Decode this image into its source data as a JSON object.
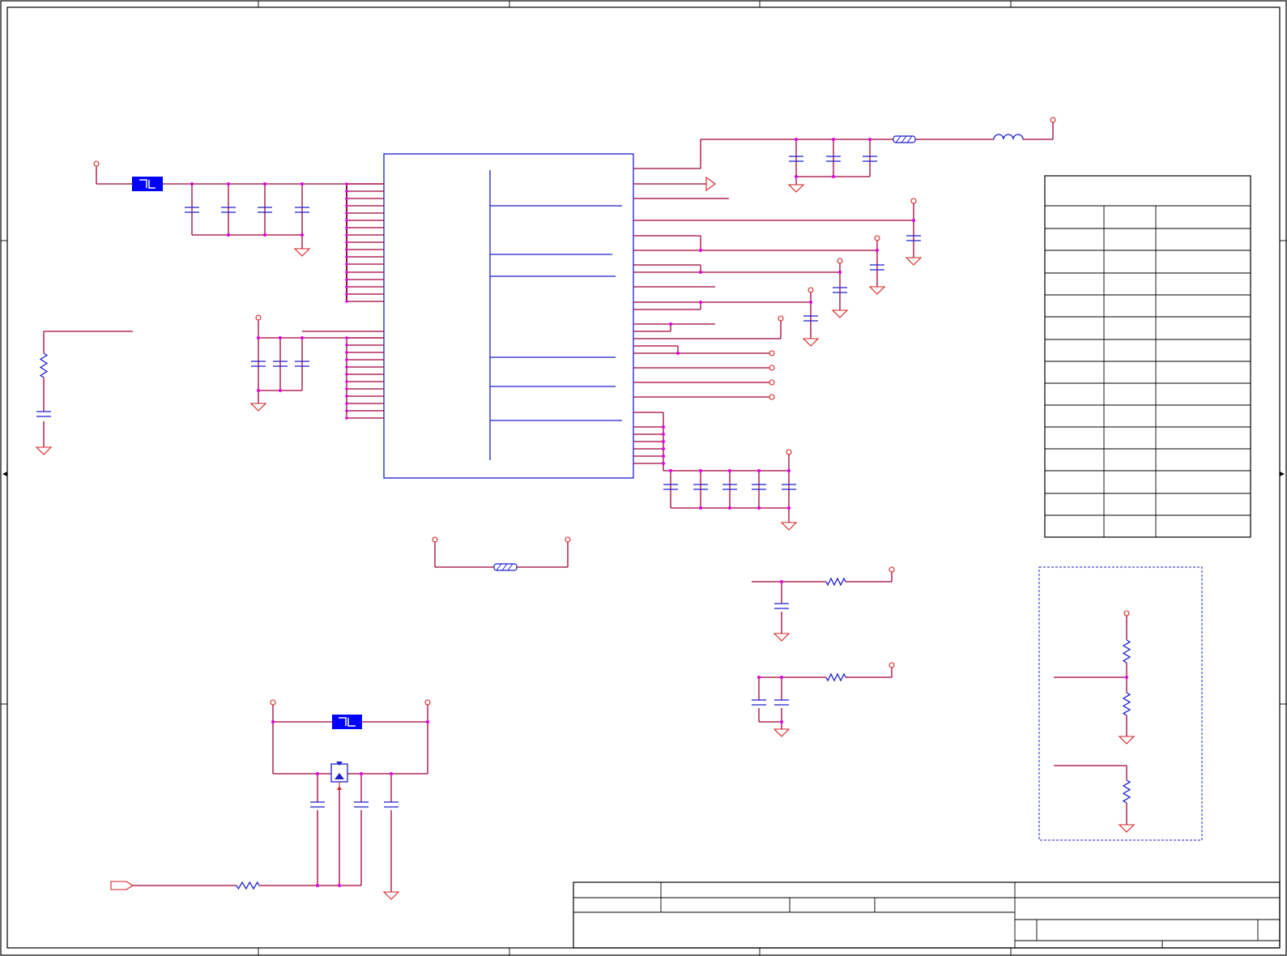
{
  "sheet": {
    "title": "",
    "colors": {
      "wire": "#a0003c",
      "component": "#1e1ecf",
      "net_port": "#d42020",
      "junction": "#e000e0",
      "frame": "#000000",
      "fuse_fill": "#0000ff"
    }
  },
  "table": {
    "rows": 13,
    "columns": 3,
    "cells": []
  },
  "title_block": {
    "cells": []
  },
  "icons": [
    "ground-icon",
    "capacitor-icon",
    "resistor-icon",
    "inductor-icon",
    "ferrite-bead-icon",
    "fuse-icon",
    "regulator-icon",
    "power-port-icon",
    "net-label-icon"
  ]
}
